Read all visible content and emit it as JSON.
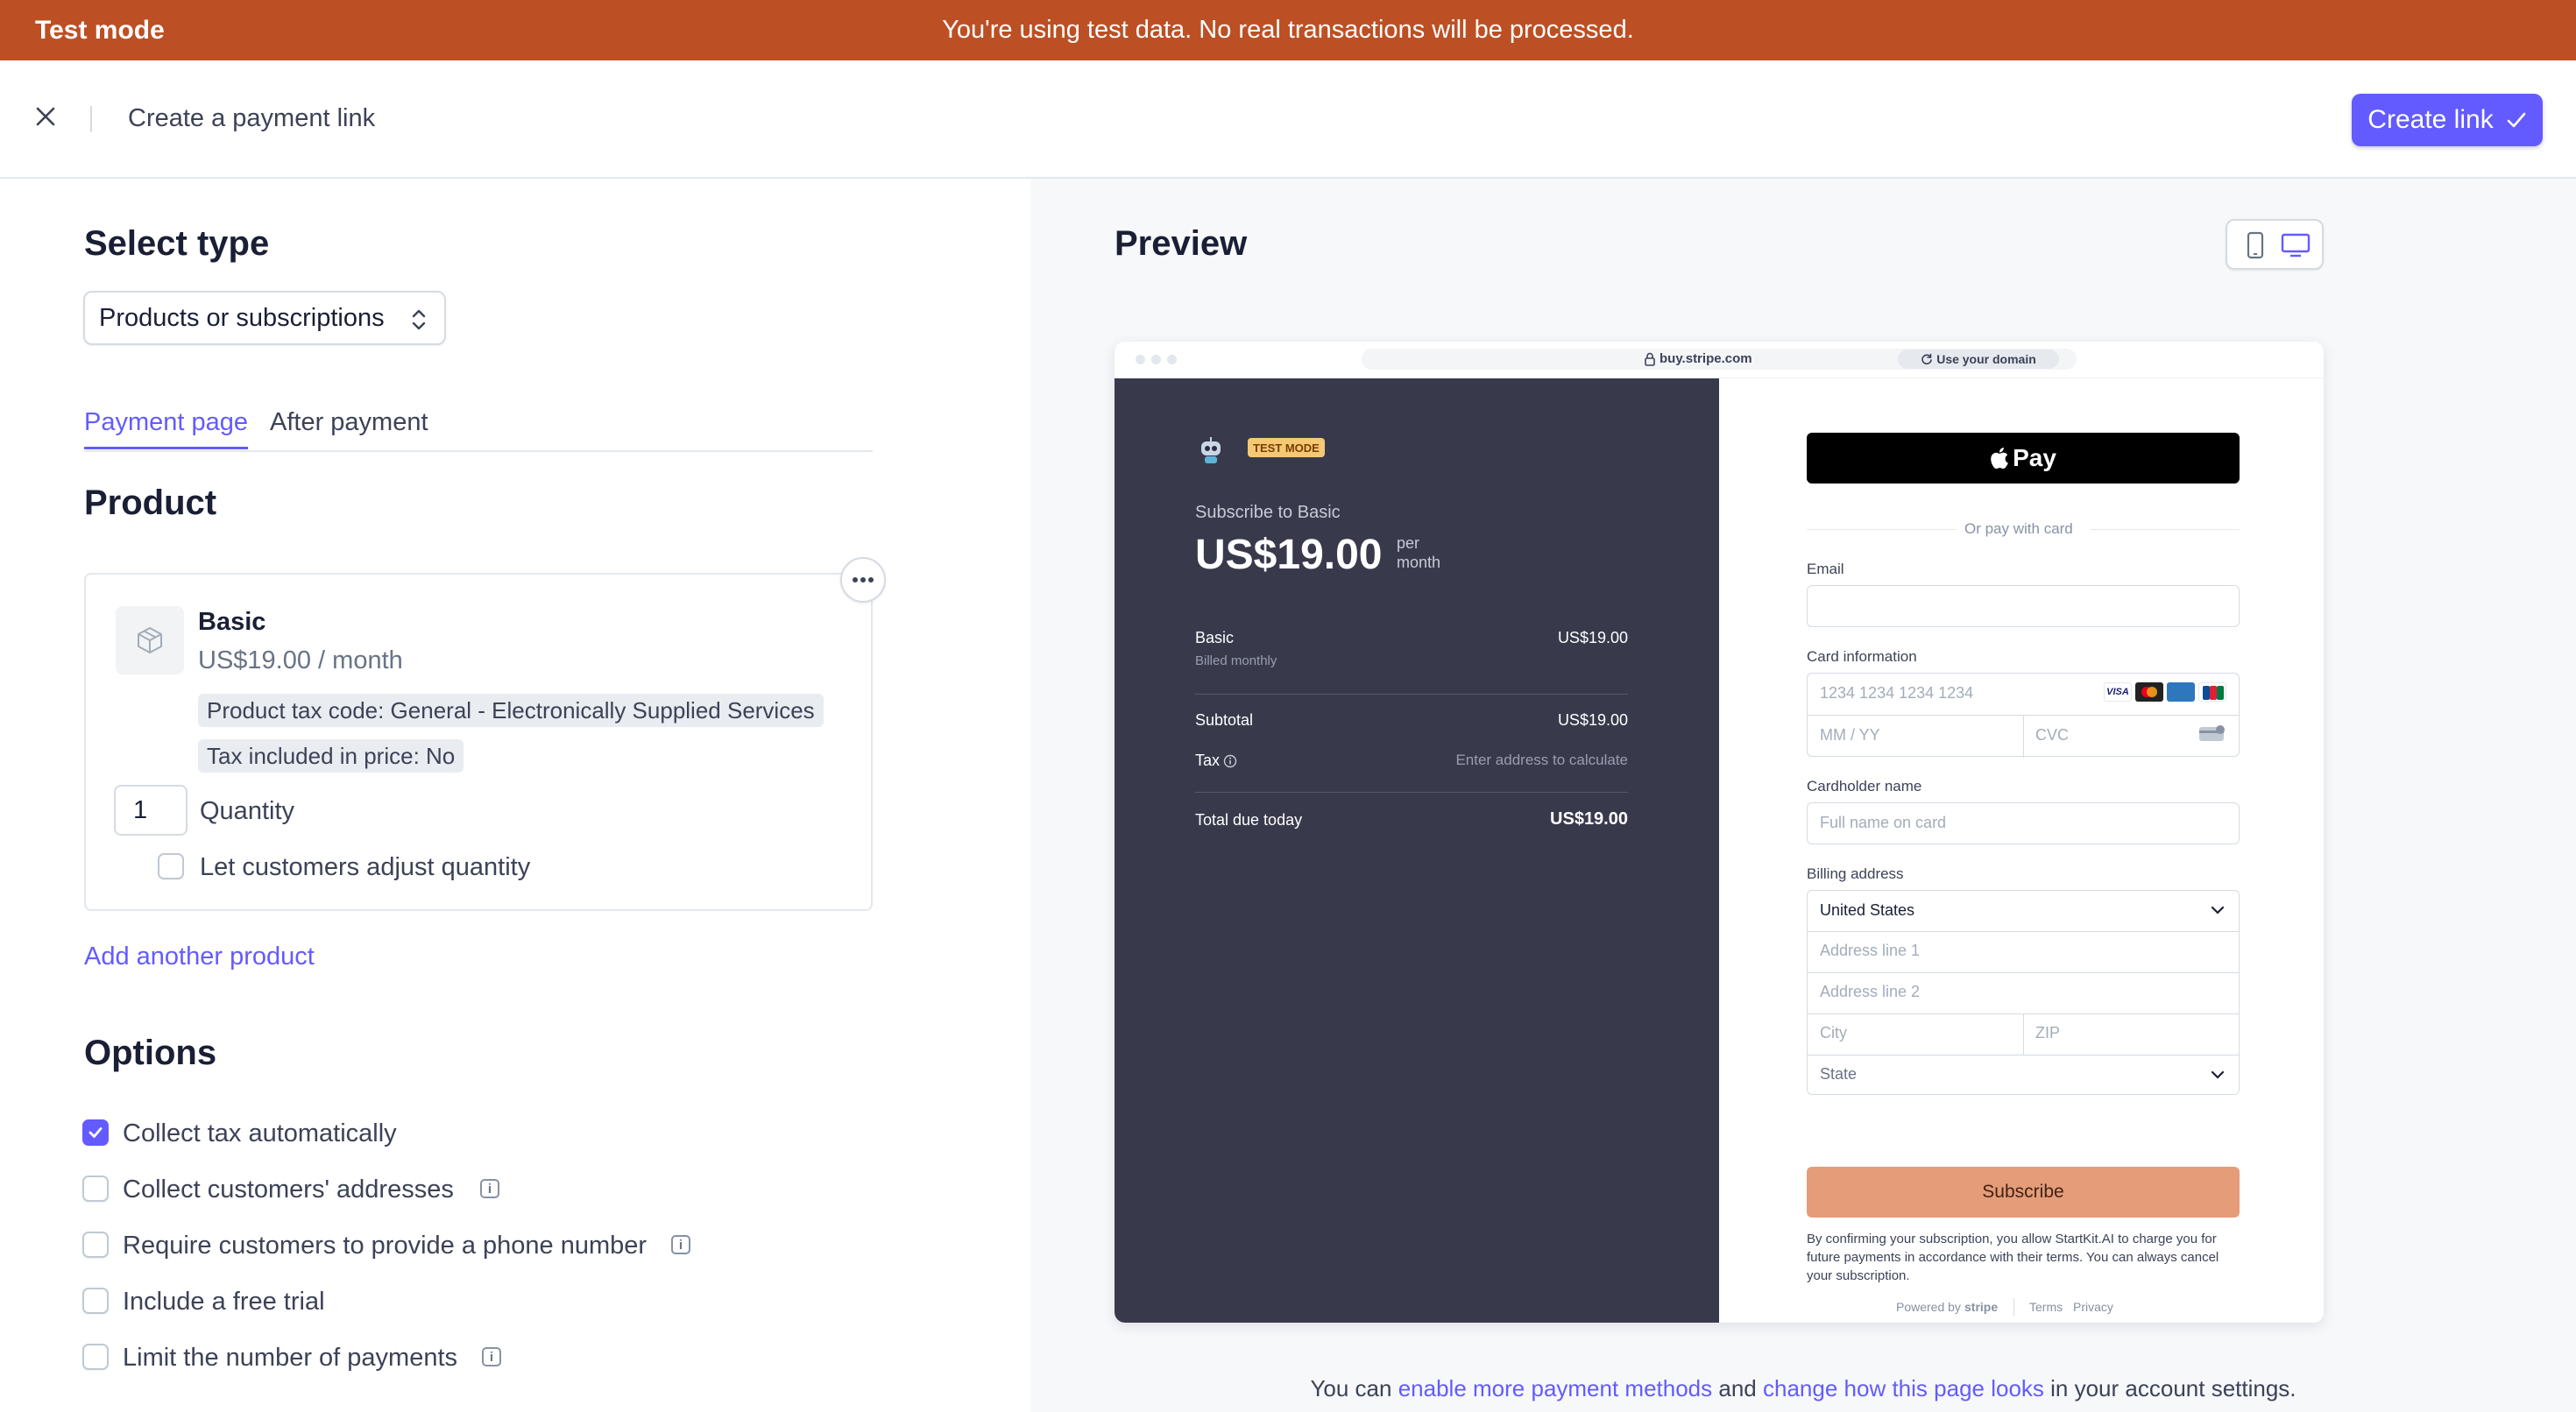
{
  "banner": {
    "label": "Test mode",
    "message": "You're using test data. No real transactions will be processed."
  },
  "header": {
    "title": "Create a payment link",
    "create_label": "Create link"
  },
  "select_type": {
    "heading": "Select type",
    "value": "Products or subscriptions"
  },
  "tabs": [
    {
      "label": "Payment page",
      "active": true
    },
    {
      "label": "After payment",
      "active": false
    }
  ],
  "product": {
    "heading": "Product",
    "name": "Basic",
    "price": "US$19.00 / month",
    "tax_code": "Product tax code: General - Electronically Supplied Services",
    "tax_included": "Tax included in price: No",
    "quantity": "1",
    "quantity_label": "Quantity",
    "adjust_label": "Let customers adjust quantity",
    "add_another": "Add another product"
  },
  "options": {
    "heading": "Options",
    "items": [
      {
        "label": "Collect tax automatically",
        "checked": true,
        "info": false
      },
      {
        "label": "Collect customers' addresses",
        "checked": false,
        "info": true
      },
      {
        "label": "Require customers to provide a phone number",
        "checked": false,
        "info": true
      },
      {
        "label": "Include a free trial",
        "checked": false,
        "info": false
      },
      {
        "label": "Limit the number of payments",
        "checked": false,
        "info": true
      }
    ]
  },
  "preview": {
    "heading": "Preview",
    "url": "buy.stripe.com",
    "use_domain": "Use your domain",
    "test_badge": "TEST MODE",
    "subscribe_to": "Subscribe to Basic",
    "amount": "US$19.00",
    "per": "per",
    "period": "month",
    "line_name": "Basic",
    "line_sub": "Billed monthly",
    "line_amount": "US$19.00",
    "subtotal_label": "Subtotal",
    "subtotal_amount": "US$19.00",
    "tax_label": "Tax",
    "tax_value": "Enter address to calculate",
    "total_label": "Total due today",
    "total_amount": "US$19.00",
    "apple_pay": "Pay",
    "or_pay": "Or pay with card",
    "email_label": "Email",
    "card_label": "Card information",
    "card_ph": "1234 1234 1234 1234",
    "expiry_ph": "MM / YY",
    "cvc_ph": "CVC",
    "cardholder_label": "Cardholder name",
    "cardholder_ph": "Full name on card",
    "billing_label": "Billing address",
    "country": "United States",
    "addr1_ph": "Address line 1",
    "addr2_ph": "Address line 2",
    "city_ph": "City",
    "zip_ph": "ZIP",
    "state_ph": "State",
    "subscribe_btn": "Subscribe",
    "legal": "By confirming your subscription, you allow StartKit.AI to charge you for future payments in accordance with their terms. You can always cancel your subscription.",
    "powered_by": "Powered by",
    "stripe": "stripe",
    "terms": "Terms",
    "privacy": "Privacy"
  },
  "bottom_note": {
    "prefix": "You can",
    "link1": "enable more payment methods",
    "middle": "and",
    "link2": "change how this page looks",
    "suffix": "in your account settings."
  },
  "colors": {
    "banner": "#bc5024",
    "accent": "#635bff",
    "summary_bg": "#383a4c",
    "subscribe_btn": "#e59c78"
  }
}
